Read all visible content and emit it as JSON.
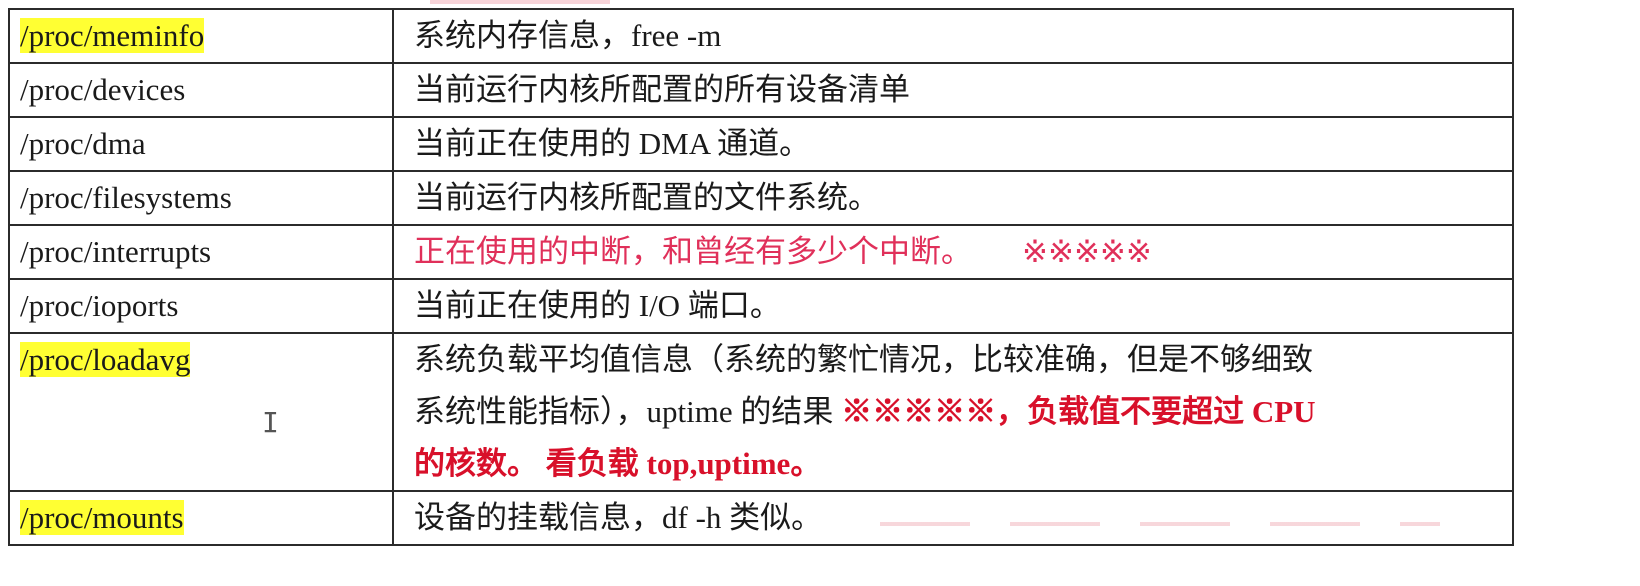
{
  "rows": [
    {
      "path": "/proc/meminfo",
      "highlight": true,
      "desc": "系统内存信息，free -m"
    },
    {
      "path": "/proc/devices",
      "highlight": false,
      "desc": "当前运行内核所配置的所有设备清单"
    },
    {
      "path": "/proc/dma",
      "highlight": false,
      "desc": "当前正在使用的 DMA 通道。"
    },
    {
      "path": "/proc/filesystems",
      "highlight": false,
      "desc": "当前运行内核所配置的文件系统。"
    },
    {
      "path": "/proc/interrupts",
      "highlight": false,
      "desc": "正在使用的中断，和曾经有多少个中断。",
      "desc_stars": "※※※※※"
    },
    {
      "path": "/proc/ioports",
      "highlight": false,
      "desc": "当前正在使用的 I/O 端口。"
    },
    {
      "path": "/proc/loadavg",
      "highlight": true,
      "desc_line1": "系统负载平均值信息（系统的繁忙情况，比较准确，但是不够细致",
      "desc_line2_plain": "系统性能指标），uptime 的结果 ",
      "desc_line2_emph": "※※※※※，负载值不要超过 CPU",
      "desc_line3": "的核数。 看负载 top,uptime。"
    },
    {
      "path": "/proc/mounts",
      "highlight": true,
      "desc": "设备的挂载信息，df -h 类似。"
    }
  ],
  "cursor_glyph": "I",
  "colors": {
    "highlight": "#ffff33",
    "red_text": "#e0305a",
    "dark_red_text": "#d8102a",
    "border": "#2b2b2b"
  }
}
